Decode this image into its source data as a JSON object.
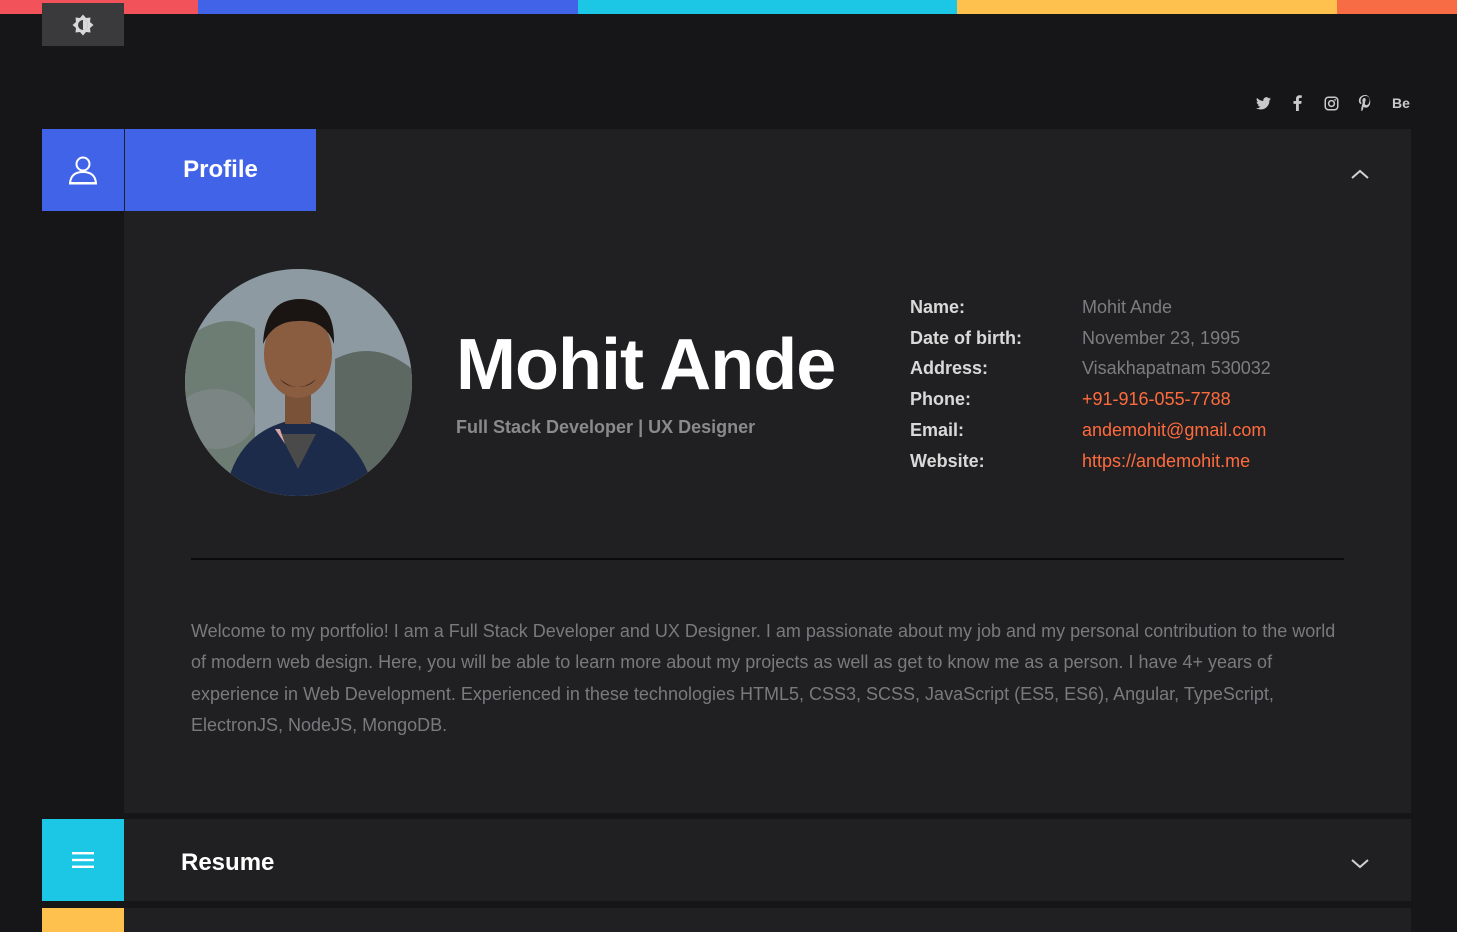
{
  "colors": {
    "stripe": [
      "#f2525a",
      "#4163e8",
      "#1cc7e6",
      "#ffc14d",
      "#f76c45"
    ],
    "accent_blue": "#4163e8",
    "accent_cyan": "#1cc7e6",
    "accent_yellow": "#ffc14d",
    "link": "#ff6b3d"
  },
  "header": {
    "theme_toggle_icon": "brightness-icon",
    "socials": [
      {
        "name": "twitter-icon",
        "glyph": "🐦"
      },
      {
        "name": "facebook-icon",
        "glyph": "f"
      },
      {
        "name": "instagram-icon",
        "glyph": "◎"
      },
      {
        "name": "pinterest-icon",
        "glyph": "P"
      },
      {
        "name": "behance-icon",
        "glyph": "Be"
      }
    ]
  },
  "profile": {
    "title": "Profile",
    "name": "Mohit Ande",
    "subtitle": "Full Stack Developer | UX Designer",
    "details": [
      {
        "label": "Name:",
        "value": "Mohit Ande"
      },
      {
        "label": "Date of birth:",
        "value": "November 23, 1995"
      },
      {
        "label": "Address:",
        "value": "Visakhapatnam 530032"
      },
      {
        "label": "Phone:",
        "value": "+91-916-055-7788"
      },
      {
        "label": "Email:",
        "value": "andemohit@gmail.com"
      },
      {
        "label": "Website:",
        "value": "https://andemohit.me"
      }
    ],
    "bio": "Welcome to my portfolio! I am a Full Stack Developer and UX Designer. I am passionate about my job and my personal contribution to the world of modern web design. Here, you will be able to learn more about my projects as well as get to know me as a person. I have 4+ years of experience in Web Development. Experienced in these technologies HTML5, CSS3, SCSS, JavaScript (ES5, ES6), Angular, TypeScript, ElectronJS, NodeJS, MongoDB."
  },
  "resume": {
    "title": "Resume"
  }
}
